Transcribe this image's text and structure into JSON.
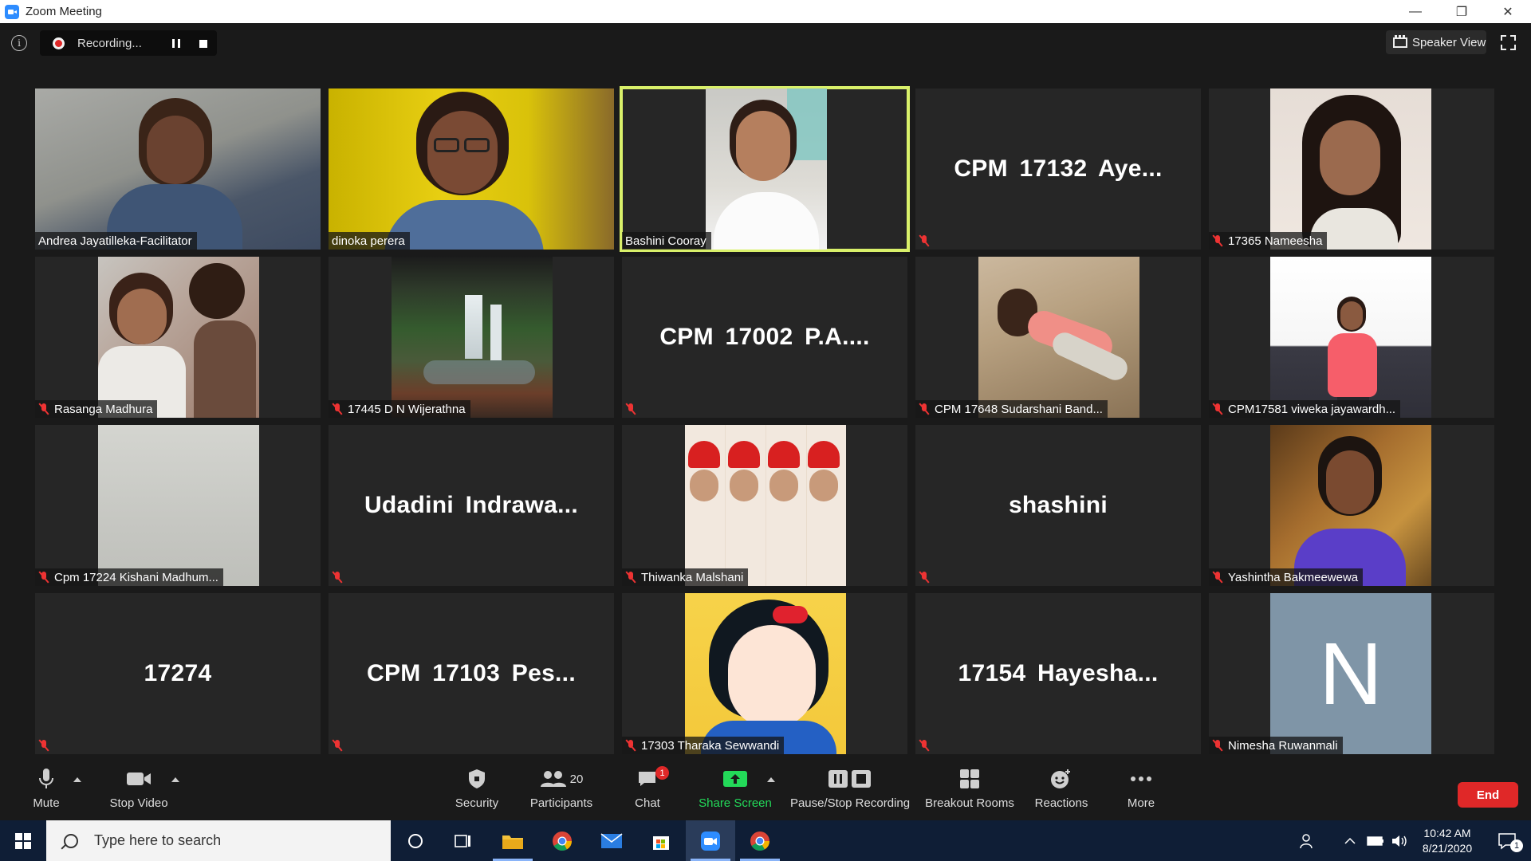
{
  "window": {
    "title": "Zoom Meeting",
    "minimize_glyph": "—",
    "restore_glyph": "❐",
    "close_glyph": "✕"
  },
  "top": {
    "info_glyph": "i",
    "recording_label": "Recording...",
    "speaker_view_label": "Speaker View"
  },
  "participants": [
    {
      "name": "Andrea Jayatilleka-Facilitator",
      "muted": false,
      "kind": "video"
    },
    {
      "name": "dinoka perera",
      "muted": false,
      "kind": "video"
    },
    {
      "name": "Bashini Cooray",
      "muted": false,
      "kind": "video",
      "active": true
    },
    {
      "name": "CPM 17132 Aye...",
      "muted": true,
      "kind": "name"
    },
    {
      "name": "17365 Nameesha",
      "muted": true,
      "kind": "video"
    },
    {
      "name": "Rasanga Madhura",
      "muted": true,
      "kind": "video"
    },
    {
      "name": "17445 D N Wijerathna",
      "muted": true,
      "kind": "video"
    },
    {
      "name": "CPM 17002 P.A....",
      "muted": true,
      "kind": "name"
    },
    {
      "name": "CPM 17648 Sudarshani Band...",
      "muted": true,
      "kind": "video"
    },
    {
      "name": "CPM17581 viweka jayawardh...",
      "muted": true,
      "kind": "video"
    },
    {
      "name": "Cpm 17224 Kishani Madhum...",
      "muted": true,
      "kind": "video"
    },
    {
      "name": "Udadini Indrawa...",
      "muted": true,
      "kind": "name"
    },
    {
      "name": "Thiwanka Malshani",
      "muted": true,
      "kind": "video"
    },
    {
      "name": "shashini",
      "muted": true,
      "kind": "name"
    },
    {
      "name": "Yashintha Bakmeewewa",
      "muted": true,
      "kind": "video"
    },
    {
      "name": "17274",
      "muted": true,
      "kind": "name"
    },
    {
      "name": "CPM 17103 Pes...",
      "muted": true,
      "kind": "name"
    },
    {
      "name": "17303 Tharaka Sewwandi",
      "muted": true,
      "kind": "video"
    },
    {
      "name": "17154 Hayesha...",
      "muted": true,
      "kind": "name"
    },
    {
      "name": "Nimesha Ruwanmali",
      "muted": true,
      "kind": "avatar",
      "initial": "N"
    }
  ],
  "toolbar": {
    "mute": "Mute",
    "stop_video": "Stop Video",
    "security": "Security",
    "participants": "Participants",
    "participants_count": "20",
    "chat": "Chat",
    "chat_badge": "1",
    "share_screen": "Share Screen",
    "pause_stop_recording": "Pause/Stop Recording",
    "breakout_rooms": "Breakout Rooms",
    "reactions": "Reactions",
    "more": "More",
    "end": "End"
  },
  "taskbar": {
    "search_placeholder": "Type here to search",
    "time": "10:42 AM",
    "date": "8/21/2020",
    "notification_count": "1"
  },
  "colors": {
    "accent_active_border": "#d9f06a",
    "end_button": "#e02828",
    "share_screen": "#23d959",
    "muted_mic": "#e33333"
  }
}
